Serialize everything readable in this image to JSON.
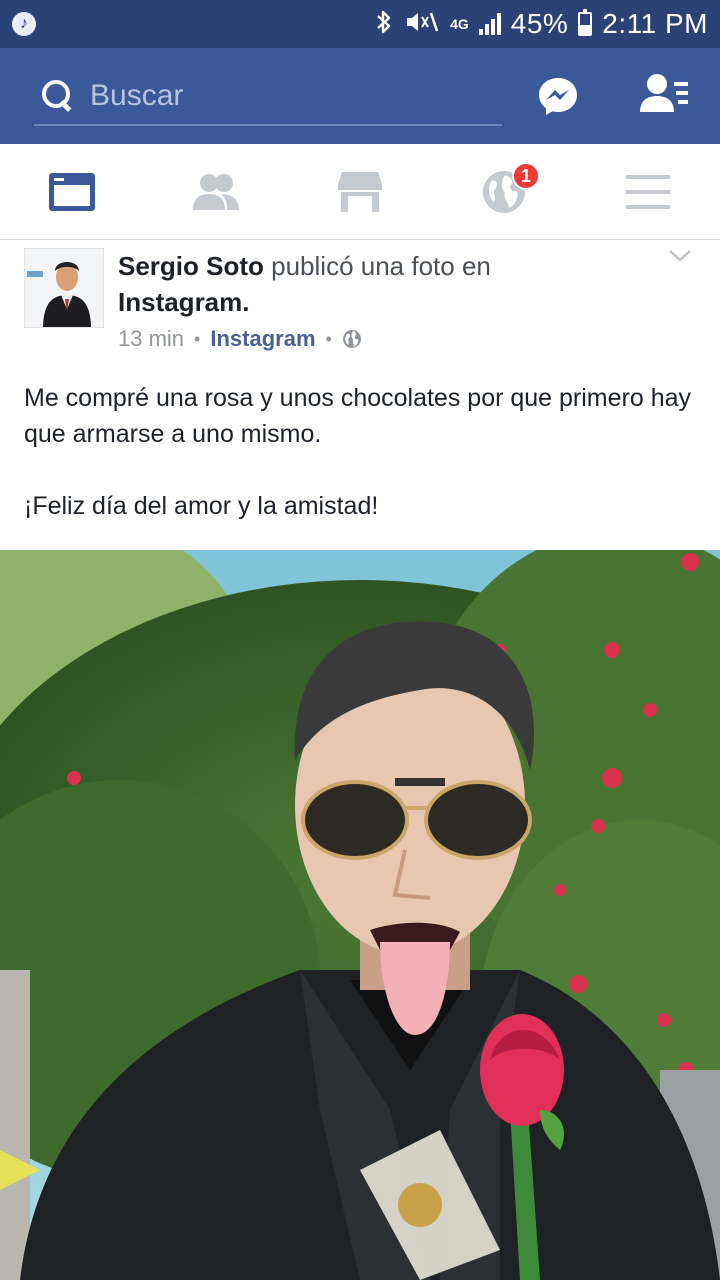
{
  "status_bar": {
    "battery_text": "45%",
    "battery_level": 0.45,
    "network": "4G",
    "time": "2:11 PM",
    "icons": [
      "music-icon",
      "bluetooth-icon",
      "mute-icon",
      "signal-icon",
      "battery-icon"
    ]
  },
  "search": {
    "placeholder": "Buscar"
  },
  "header_icons": [
    "search-icon",
    "messenger-icon",
    "friend-requests-icon"
  ],
  "tabs": [
    {
      "name": "news-feed",
      "icon": "news-feed-icon",
      "active": true
    },
    {
      "name": "friends",
      "icon": "friends-icon",
      "active": false
    },
    {
      "name": "marketplace",
      "icon": "marketplace-icon",
      "active": false
    },
    {
      "name": "notifications",
      "icon": "globe-icon",
      "active": false,
      "badge": "1"
    },
    {
      "name": "menu",
      "icon": "menu-icon",
      "active": false
    }
  ],
  "post": {
    "author": "Sergio Soto",
    "action": "publicó una foto en",
    "target": "Instagram.",
    "time": "13 min",
    "source": "Instagram",
    "privacy_icon": "globe-icon",
    "text_line1": "Me compré una rosa y unos chocolates por que primero hay que armarse a uno mismo.",
    "text_line2": "¡Feliz día del amor y la amistad!"
  },
  "colors": {
    "status_bar": "#2b4277",
    "header": "#3b5998",
    "active_tab": "#3b5998",
    "inactive_tab": "#c5c9d0",
    "badge": "#ef3b35"
  }
}
